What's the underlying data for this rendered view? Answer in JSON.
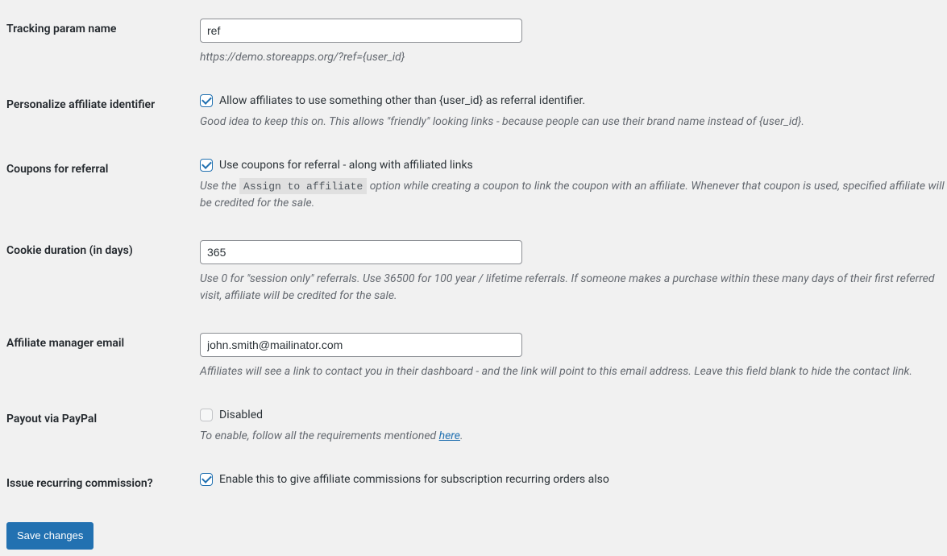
{
  "fields": {
    "tracking_param": {
      "label": "Tracking param name",
      "value": "ref",
      "description": "https://demo.storeapps.org/?ref={user_id}"
    },
    "personalize_identifier": {
      "label": "Personalize affiliate identifier",
      "checked": true,
      "checkbox_label": "Allow affiliates to use something other than {user_id} as referral identifier.",
      "description": "Good idea to keep this on. This allows \"friendly\" looking links - because people can use their brand name instead of {user_id}."
    },
    "coupons_referral": {
      "label": "Coupons for referral",
      "checked": true,
      "checkbox_label": "Use coupons for referral - along with affiliated links",
      "description_pre": "Use the ",
      "description_code": "Assign to affiliate",
      "description_post": " option while creating a coupon to link the coupon with an affiliate. Whenever that coupon is used, specified affiliate will be credited for the sale."
    },
    "cookie_duration": {
      "label": "Cookie duration (in days)",
      "value": "365",
      "description": "Use 0 for \"session only\" referrals. Use 36500 for 100 year / lifetime referrals. If someone makes a purchase within these many days of their first referred visit, affiliate will be credited for the sale."
    },
    "manager_email": {
      "label": "Affiliate manager email",
      "value": "john.smith@mailinator.com",
      "description": "Affiliates will see a link to contact you in their dashboard - and the link will point to this email address. Leave this field blank to hide the contact link."
    },
    "payout_paypal": {
      "label": "Payout via PayPal",
      "checked": false,
      "disabled": true,
      "checkbox_label": "Disabled",
      "description_pre": "To enable, follow all the requirements mentioned ",
      "description_link": "here",
      "description_post": "."
    },
    "recurring_commission": {
      "label": "Issue recurring commission?",
      "checked": true,
      "checkbox_label": "Enable this to give affiliate commissions for subscription recurring orders also"
    }
  },
  "save_button": "Save changes"
}
